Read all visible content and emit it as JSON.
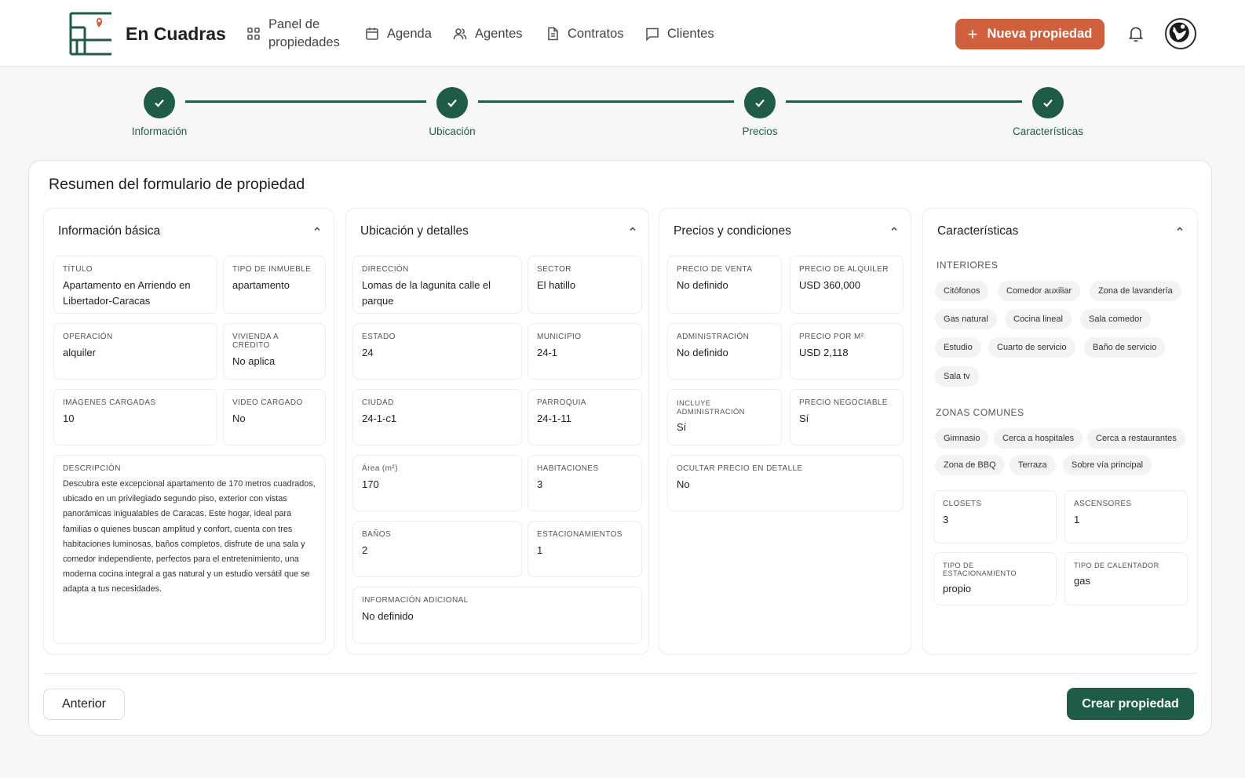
{
  "brand": {
    "name": "En Cuadras"
  },
  "nav": {
    "panel": "Panel de propiedades",
    "agenda": "Agenda",
    "agentes": "Agentes",
    "contratos": "Contratos",
    "clientes": "Clientes"
  },
  "header": {
    "new_property": "Nueva propiedad"
  },
  "colors": {
    "accent": "#d0603d",
    "primary": "#1f5c47"
  },
  "stepper": {
    "steps": [
      {
        "label": "Información",
        "status": "completed"
      },
      {
        "label": "Ubicación",
        "status": "completed"
      },
      {
        "label": "Precios",
        "status": "completed"
      },
      {
        "label": "Características",
        "status": "completed"
      }
    ]
  },
  "summary": {
    "title": "Resumen del formulario de propiedad",
    "basic": {
      "title": "Información básica",
      "titulo": {
        "label": "Título",
        "value": "Apartamento en Arriendo en Libertador-Caracas"
      },
      "tipo_inmueble": {
        "label": "Tipo de inmueble",
        "value": "apartamento"
      },
      "operacion": {
        "label": "Operación",
        "value": "alquiler"
      },
      "vivienda_credito": {
        "label": "Vivienda a crédito",
        "value": "No aplica"
      },
      "imagenes": {
        "label": "Imágenes cargadas",
        "value": "10"
      },
      "video": {
        "label": "Video cargado",
        "value": "No"
      },
      "descripcion": {
        "label": "Descripción",
        "value": "Descubra este excepcional apartamento de 170 metros cuadrados, ubicado en un privilegiado segundo piso, exterior con vistas panorámicas inigualables de Caracas. Este hogar, ideal para familias o quienes buscan amplitud y confort, cuenta con tres habitaciones luminosas, baños completos, disfrute de una sala y comedor independiente, perfectos para el entretenimiento, una moderna cocina integral a gas natural y un estudio versátil que se adapta a tus necesidades."
      }
    },
    "location": {
      "title": "Ubicación y detalles",
      "direccion": {
        "label": "Dirección",
        "value": "Lomas de la lagunita calle el parque"
      },
      "sector": {
        "label": "Sector",
        "value": "El hatillo"
      },
      "estado": {
        "label": "Estado",
        "value": "24"
      },
      "municipio": {
        "label": "Municipio",
        "value": "24-1"
      },
      "ciudad": {
        "label": "Ciudad",
        "value": "24-1-c1"
      },
      "parroquia": {
        "label": "Parroquia",
        "value": "24-1-11"
      },
      "area": {
        "label": "Área (m²)",
        "value": "170"
      },
      "habitaciones": {
        "label": "Habitaciones",
        "value": "3"
      },
      "banos": {
        "label": "Baños",
        "value": "2"
      },
      "estacionamientos": {
        "label": "Estacionamientos",
        "value": "1"
      },
      "info_adicional": {
        "label": "Información adicional",
        "value": "No definido"
      }
    },
    "prices": {
      "title": "Precios y condiciones",
      "precio_venta": {
        "label": "Precio de venta",
        "value": "No definido"
      },
      "precio_alquiler": {
        "label": "Precio de alquiler",
        "value": "USD 360,000"
      },
      "administracion": {
        "label": "Administración",
        "value": "No definido"
      },
      "precio_m2": {
        "label": "Precio por m²",
        "value": "USD 2,118"
      },
      "incluye_admin": {
        "label": "Incluye administración",
        "value": "Sí"
      },
      "negociable": {
        "label": "Precio negociable",
        "value": "Sí"
      },
      "ocultar_precio": {
        "label": "Ocultar precio en detalle",
        "value": "No"
      }
    },
    "features": {
      "title": "Características",
      "interiores_title": "INTERIORES",
      "interiores": [
        "Citófonos",
        "Comedor auxiliar",
        "Zona de lavandería",
        "Gas natural",
        "Cocina lineal",
        "Sala comedor",
        "Estudio",
        "Cuarto de servicio",
        "Baño de servicio",
        "Sala tv"
      ],
      "comunes_title": "ZONAS COMUNES",
      "comunes": [
        "Gimnasio",
        "Cerca a hospitales",
        "Cerca a restaurantes",
        "Zona de BBQ",
        "Terraza",
        "Sobre vía principal"
      ],
      "closets": {
        "label": "Closets",
        "value": "3"
      },
      "ascensores": {
        "label": "Ascensores",
        "value": "1"
      },
      "tipo_estacionamiento": {
        "label": "Tipo de estacionamiento",
        "value": "propio"
      },
      "tipo_calentador": {
        "label": "Tipo de calentador",
        "value": "gas"
      }
    }
  },
  "footer": {
    "prev": "Anterior",
    "create": "Crear propiedad"
  }
}
